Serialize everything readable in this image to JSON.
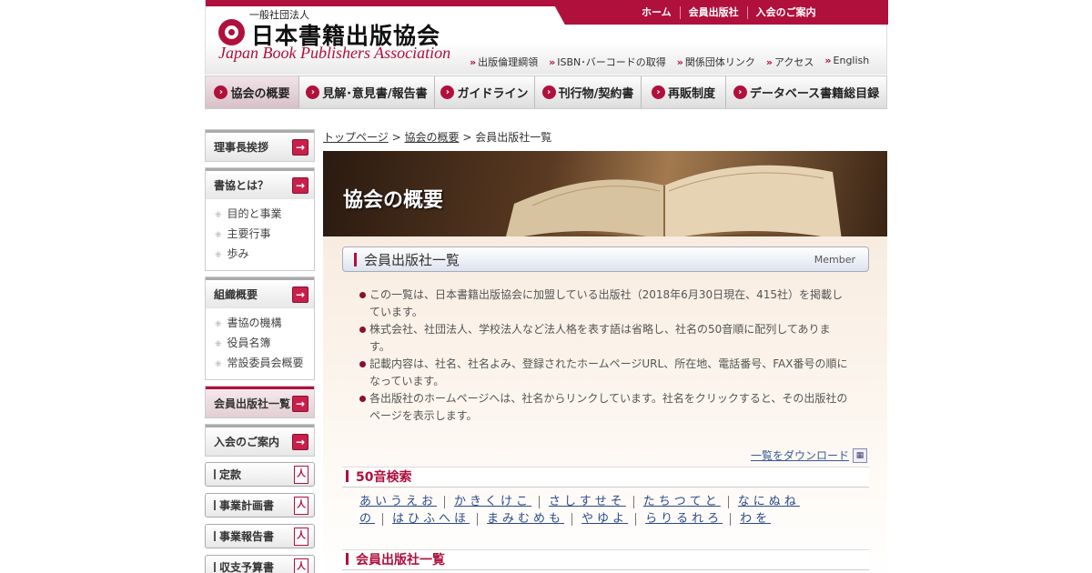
{
  "header": {
    "org_type": "一般社団法人",
    "org_name_jp": "日本書籍出版協会",
    "org_name_en": "Japan Book Publishers Association",
    "top_links": [
      "ホーム",
      "会員出版社",
      "入会のご案内"
    ],
    "sub_links": [
      "出版倫理綱領",
      "ISBN･バーコードの取得",
      "関係団体リンク",
      "アクセス",
      "English"
    ]
  },
  "nav": {
    "items": [
      "協会の概要",
      "見解･意見書/報告書",
      "ガイドライン",
      "刊行物/契約書",
      "再販制度",
      "データベース書籍総目録"
    ]
  },
  "sidebar": {
    "greeting": "理事長挨拶",
    "about": {
      "title": "書協とは？",
      "items": [
        "目的と事業",
        "主要行事",
        "歩み"
      ]
    },
    "organization": {
      "title": "組織概要",
      "items": [
        "書協の機構",
        "役員名簿",
        "常設委員会概要"
      ]
    },
    "members": "会員出版社一覧",
    "join": "入会のご案内",
    "pdfs": [
      "定款",
      "事業計画書",
      "事業報告書",
      "収支予算書"
    ]
  },
  "breadcrumb": {
    "home": "トップページ",
    "about": "協会の概要",
    "current": "会員出版社一覧"
  },
  "hero_title": "協会の概要",
  "section": {
    "title": "会員出版社一覧",
    "tag": "Member",
    "notes": [
      "この一覧は、日本書籍出版協会に加盟している出版社（2018年6月30日現在、415社）を掲載しています。",
      "株式会社、社団法人、学校法人など法人格を表す語は省略し、社名の50音順に配列してあります。",
      "記載内容は、社名、社名よみ、登録されたホームページURL、所在地、電話番号、FAX番号の順になっています。",
      "各出版社のホームページへは、社名からリンクしています。社名をクリックすると、その出版社のページを表示します。"
    ],
    "download": "一覧をダウンロード"
  },
  "search": {
    "title": "50音検索",
    "row1": [
      "あいうえお",
      "かきくけこ",
      "さしすせそ",
      "たちつてと",
      "なにぬね"
    ],
    "row2": [
      "の",
      "はひふへほ",
      "まみむめも",
      "やゆよ",
      "らりるれろ",
      "わを"
    ]
  },
  "list_title": "会員出版社一覧",
  "colors": {
    "brand": "#b0103c",
    "link": "#2a4a8a"
  }
}
